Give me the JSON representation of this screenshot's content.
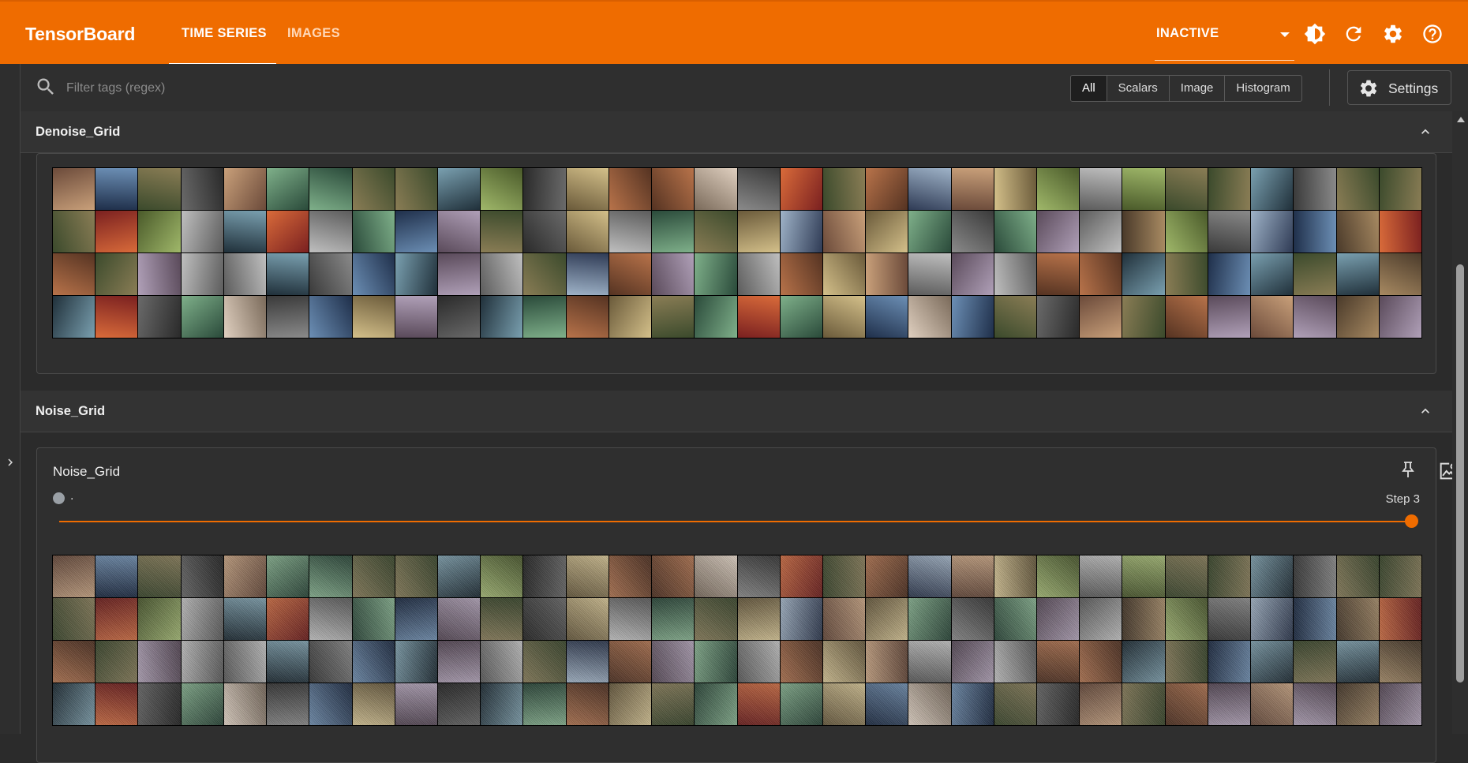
{
  "app": {
    "brand": "TensorBoard",
    "tabs": [
      {
        "label": "TIME SERIES",
        "active": true
      },
      {
        "label": "IMAGES",
        "active": false
      }
    ],
    "status_select": "INACTIVE",
    "icons": [
      "theme-toggle-icon",
      "refresh-icon",
      "settings-gear-icon",
      "help-icon"
    ],
    "accent_color": "#ef6c00"
  },
  "filter": {
    "placeholder": "Filter tags (regex)",
    "types": [
      "All",
      "Scalars",
      "Image",
      "Histogram"
    ],
    "selected_type": "All",
    "settings_label": "Settings"
  },
  "groups": [
    {
      "name": "Denoise_Grid",
      "expanded": true
    },
    {
      "name": "Noise_Grid",
      "expanded": true,
      "card": {
        "title": "Noise_Grid",
        "run_name": ".",
        "step_label": "Step 3",
        "slider_position": 1.0
      }
    }
  ]
}
